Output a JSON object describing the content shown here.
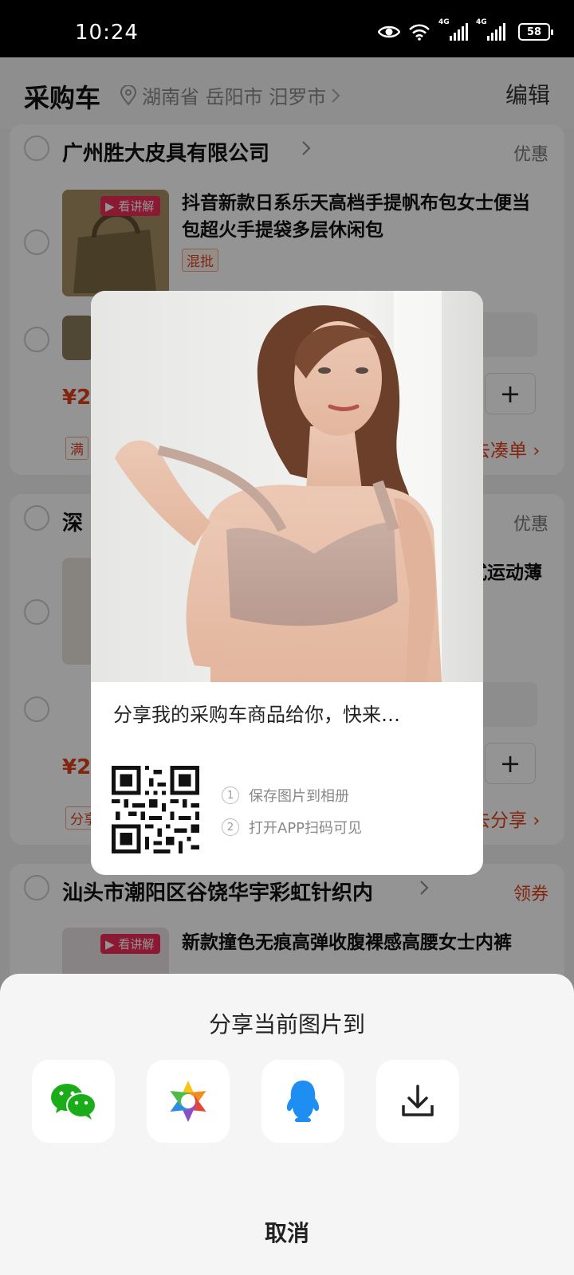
{
  "status_bar": {
    "time": "10:24",
    "battery": "58",
    "net1": "4G",
    "net2": "4G"
  },
  "header": {
    "title": "采购车",
    "location": "湖南省 岳阳市 汨罗市",
    "edit": "编辑"
  },
  "cart": {
    "shop1": {
      "name": "广州胜大皮具有限公司",
      "right": "优惠",
      "product_title": "抖音新款日系乐天高档手提帆布包女士便当包超火手提袋多层休闲包",
      "live_tag": "看讲解",
      "mix_tag": "混批",
      "price_symbol": "¥2",
      "promo_tag": "满",
      "link": "去凑单"
    },
    "shop2": {
      "name": "深",
      "right": "优惠",
      "product_title_partial": "式运动薄",
      "price_symbol": "¥2",
      "promo_tag": "分享",
      "link": "去分享"
    },
    "shop3": {
      "name": "汕头市潮阳区谷饶华宇彩虹针织内",
      "right": "领券",
      "live_tag": "看讲解",
      "product_title": "新款撞色无痕高弹收腹裸感高腰女士内裤"
    }
  },
  "share_card": {
    "text": "分享我的采购车商品给你，快来…",
    "step1_num": "1",
    "step1": "保存图片到相册",
    "step2_num": "2",
    "step2": "打开APP扫码可见"
  },
  "share_sheet": {
    "title": "分享当前图片到",
    "options": [
      {
        "icon": "wechat-icon"
      },
      {
        "icon": "moments-icon"
      },
      {
        "icon": "qq-icon"
      },
      {
        "icon": "download-icon"
      }
    ],
    "cancel": "取消"
  }
}
